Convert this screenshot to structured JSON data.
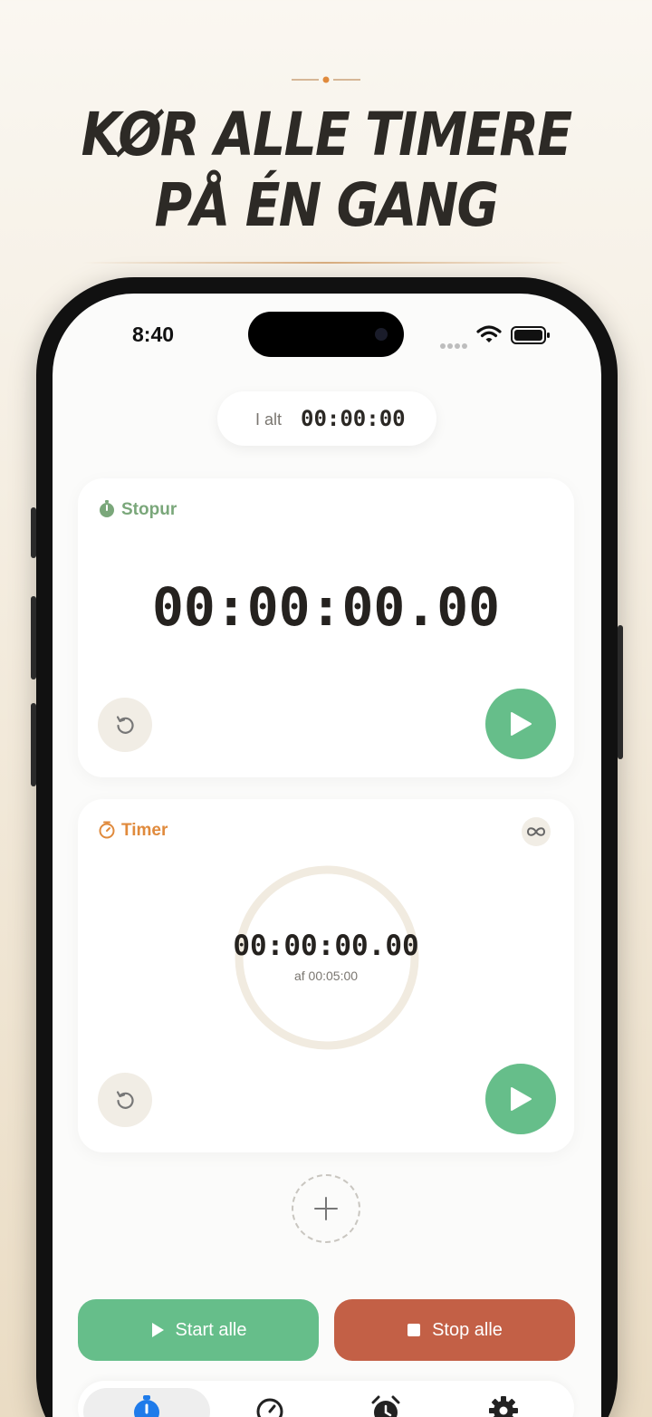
{
  "headline": {
    "line1": "KØR ALLE TIMERE",
    "line2": "PÅ ÉN GANG"
  },
  "status_bar": {
    "time": "8:40",
    "icons": [
      "signal-dots-icon",
      "wifi-icon",
      "battery-icon"
    ]
  },
  "total": {
    "label": "I alt",
    "value": "00:00:00"
  },
  "stopwatch_card": {
    "title": "Stopur",
    "icon": "stopwatch-icon",
    "display": "00:00:00.00",
    "title_color": "#7aa77a"
  },
  "timer_card": {
    "title": "Timer",
    "icon": "timer-icon",
    "display": "00:00:00.00",
    "subtitle": "af 00:05:00",
    "title_color": "#e08a3c",
    "loop_icon": "infinity-icon"
  },
  "actions": {
    "start_all": "Start alle",
    "stop_all": "Stop alle"
  },
  "tabbar": {
    "tabs": [
      {
        "icon": "stopwatch-icon",
        "active": true
      },
      {
        "icon": "timer-icon",
        "active": false
      },
      {
        "icon": "alarm-clock-icon",
        "active": false
      },
      {
        "icon": "gear-icon",
        "active": false
      }
    ]
  },
  "colors": {
    "accent_green": "#66be8a",
    "stop_red": "#c36046",
    "accent_blue": "#1f7bea"
  }
}
